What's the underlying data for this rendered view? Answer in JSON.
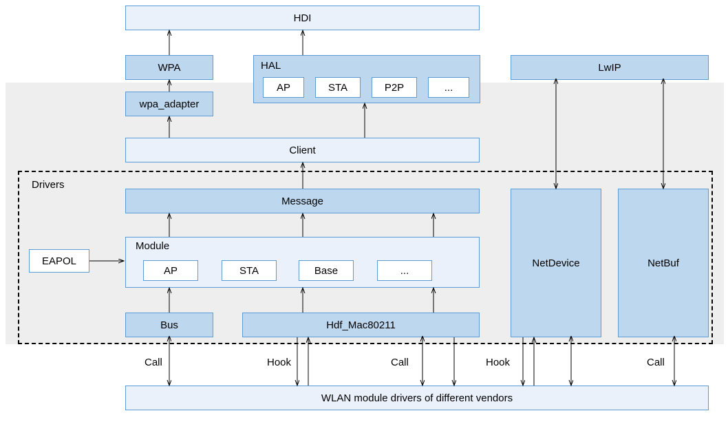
{
  "top": {
    "hdi": "HDI",
    "wpa": "WPA",
    "lwip": "LwIP",
    "hal": {
      "title": "HAL",
      "items": [
        "AP",
        "STA",
        "P2P",
        "..."
      ]
    }
  },
  "upper": {
    "wpa_adapter": "wpa_adapter",
    "client": "Client"
  },
  "drivers": {
    "title": "Drivers",
    "message": "Message",
    "eapol": "EAPOL",
    "module": {
      "title": "Module",
      "items": [
        "AP",
        "STA",
        "Base",
        "..."
      ]
    },
    "bus": "Bus",
    "hdf_mac": "Hdf_Mac80211",
    "netdevice": "NetDevice",
    "netbuf": "NetBuf"
  },
  "bottom": {
    "vendors": "WLAN module drivers of different vendors"
  },
  "edges": {
    "call1": "Call",
    "hook1": "Hook",
    "call2": "Call",
    "hook2": "Hook",
    "call3": "Call"
  }
}
